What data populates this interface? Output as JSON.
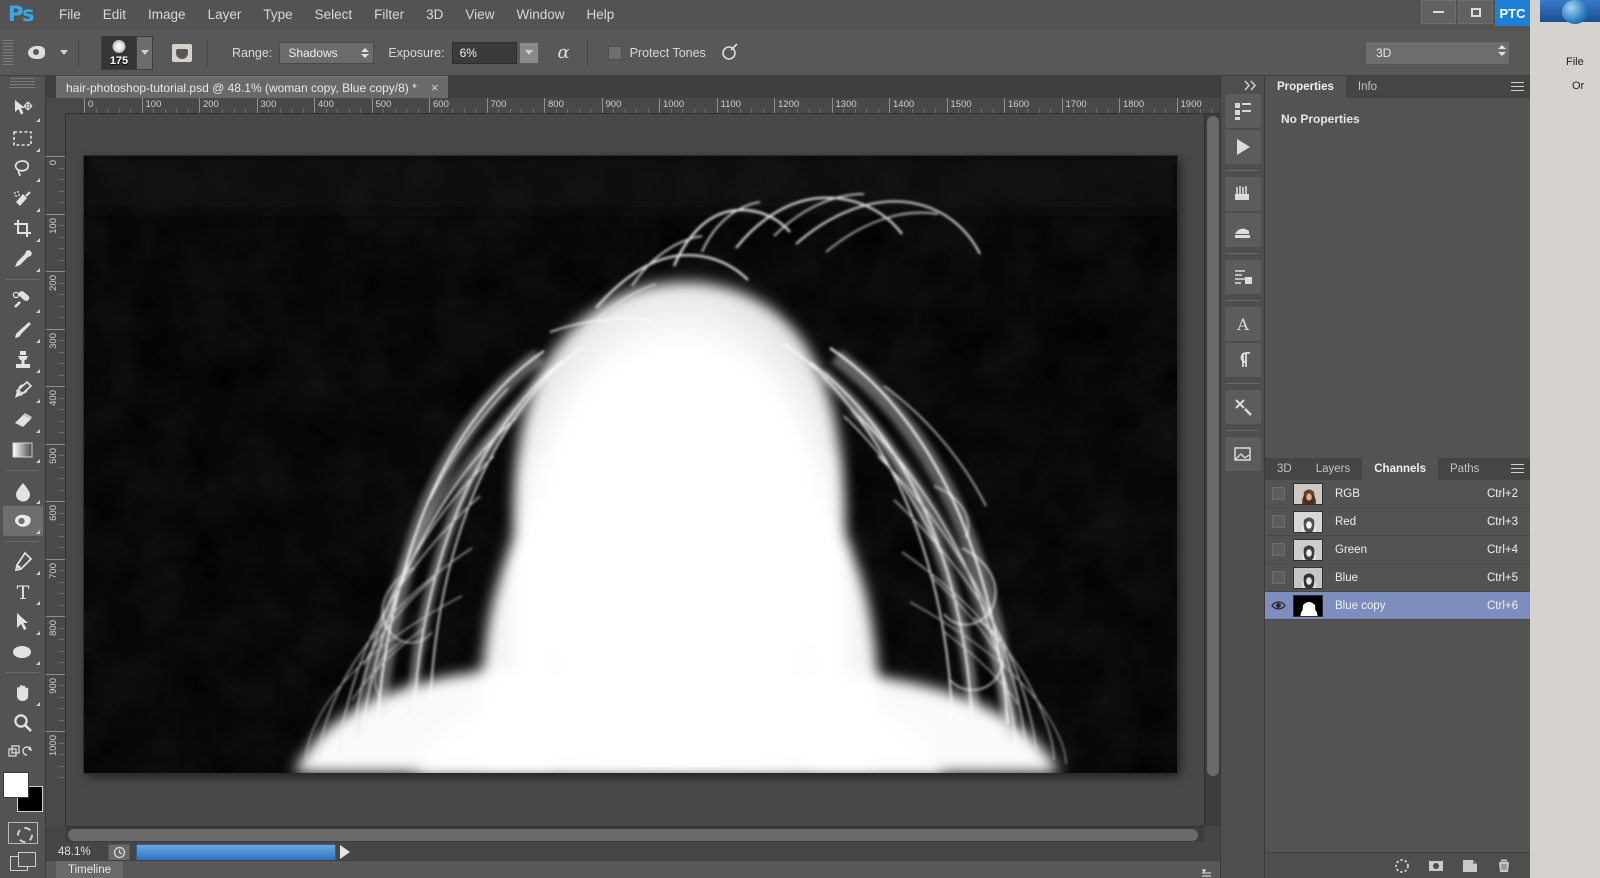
{
  "app": {
    "name": "Adobe Photoshop",
    "logo": "Ps"
  },
  "menubar": {
    "items": [
      "File",
      "Edit",
      "Image",
      "Layer",
      "Type",
      "Select",
      "Filter",
      "3D",
      "View",
      "Window",
      "Help"
    ]
  },
  "window_controls": {
    "minimize": "–",
    "maximize": "□",
    "badge": "PTC"
  },
  "options_bar": {
    "tool_icon": "burn-tool-icon",
    "brush_size": "175",
    "range_label": "Range:",
    "range_value": "Shadows",
    "exposure_label": "Exposure:",
    "exposure_value": "6%",
    "airbrush_icon": "airbrush-icon",
    "protect_tones_label": "Protect Tones",
    "protect_tones_checked": false,
    "tablet_pressure_icon": "tablet-pressure-icon",
    "workspace": "3D"
  },
  "toolbar": {
    "tools": [
      {
        "name": "move-tool",
        "has_flyout": true,
        "selected": false
      },
      {
        "name": "rectangular-marquee-tool",
        "has_flyout": true,
        "selected": false
      },
      {
        "name": "lasso-tool",
        "has_flyout": true,
        "selected": false
      },
      {
        "name": "quick-selection-tool",
        "has_flyout": true,
        "selected": false
      },
      {
        "name": "crop-tool",
        "has_flyout": true,
        "selected": false
      },
      {
        "name": "eyedropper-tool",
        "has_flyout": true,
        "selected": false
      },
      {
        "name": "spot-healing-brush-tool",
        "has_flyout": true,
        "selected": false
      },
      {
        "name": "brush-tool",
        "has_flyout": true,
        "selected": false
      },
      {
        "name": "clone-stamp-tool",
        "has_flyout": true,
        "selected": false
      },
      {
        "name": "history-brush-tool",
        "has_flyout": true,
        "selected": false
      },
      {
        "name": "eraser-tool",
        "has_flyout": true,
        "selected": false
      },
      {
        "name": "gradient-tool",
        "has_flyout": true,
        "selected": false
      },
      {
        "name": "blur-tool",
        "has_flyout": true,
        "selected": false
      },
      {
        "name": "dodge-burn-tool",
        "has_flyout": true,
        "selected": true
      },
      {
        "name": "pen-tool",
        "has_flyout": true,
        "selected": false
      },
      {
        "name": "type-tool",
        "has_flyout": true,
        "selected": false
      },
      {
        "name": "path-selection-tool",
        "has_flyout": true,
        "selected": false
      },
      {
        "name": "ellipse-shape-tool",
        "has_flyout": true,
        "selected": false
      },
      {
        "name": "hand-tool",
        "has_flyout": true,
        "selected": false
      },
      {
        "name": "zoom-tool",
        "has_flyout": false,
        "selected": false
      }
    ],
    "foreground_color": "#ffffff",
    "background_color": "#000000",
    "quick_mask_icon": "quick-mask-icon",
    "screen_mode_icon": "screen-mode-icon"
  },
  "document": {
    "tab_title": "hair-photoshop-tutorial.psd @ 48.1% (woman copy, Blue copy/8) *",
    "close_label": "×",
    "zoom": "48.1%",
    "ruler_units_h": [
      0,
      100,
      200,
      300,
      400,
      500,
      600,
      700,
      800,
      900,
      1000,
      1100,
      1200,
      1300,
      1400,
      1500,
      1600,
      1700,
      1800,
      1900
    ],
    "ruler_units_v": [
      0,
      100,
      200,
      300,
      400,
      500,
      600,
      700,
      800,
      900,
      1000
    ],
    "canvas_description": "black-and-white hair mask channel of a woman seen from behind, white silhouette on black"
  },
  "statusbar": {
    "zoom": "48.1%",
    "clock_icon": "timing-icon",
    "progress_percent": 100,
    "play_icon": "play-icon"
  },
  "timeline": {
    "label": "Timeline",
    "menu_icon": "panel-menu-icon"
  },
  "dock": {
    "collapse_icon": "collapse-to-icons-icon",
    "icons": [
      "mini-bridge-icon",
      "timeline-icon",
      "brush-panel-icon",
      "swatches-panel-icon",
      "adjustments-panel-icon",
      "character-panel-icon",
      "paragraph-panel-icon",
      "tool-presets-icon",
      "notes-panel-icon"
    ]
  },
  "properties_panel": {
    "tabs": [
      {
        "label": "Properties",
        "active": true
      },
      {
        "label": "Info",
        "active": false
      }
    ],
    "empty_message": "No Properties",
    "menu_icon": "panel-menu-icon"
  },
  "channels_panel": {
    "tabs": [
      {
        "label": "3D",
        "active": false
      },
      {
        "label": "Layers",
        "active": false
      },
      {
        "label": "Channels",
        "active": true
      },
      {
        "label": "Paths",
        "active": false
      }
    ],
    "menu_icon": "panel-menu-icon",
    "rows": [
      {
        "name": "RGB",
        "shortcut": "Ctrl+2",
        "visible": false,
        "selected": false,
        "thumb": "color"
      },
      {
        "name": "Red",
        "shortcut": "Ctrl+3",
        "visible": false,
        "selected": false,
        "thumb": "gray"
      },
      {
        "name": "Green",
        "shortcut": "Ctrl+4",
        "visible": false,
        "selected": false,
        "thumb": "gray"
      },
      {
        "name": "Blue",
        "shortcut": "Ctrl+5",
        "visible": false,
        "selected": false,
        "thumb": "gray"
      },
      {
        "name": "Blue copy",
        "shortcut": "Ctrl+6",
        "visible": true,
        "selected": true,
        "thumb": "mask"
      }
    ],
    "footer_icons": [
      "load-channel-as-selection-icon",
      "save-selection-as-channel-icon",
      "create-new-channel-icon",
      "delete-channel-icon"
    ]
  },
  "background_app": {
    "menu_label": "File",
    "submenu_label": "Or"
  },
  "colors": {
    "chrome": "#535353",
    "panel": "#535353",
    "selection_blue": "#7d8dbe",
    "accent_blue": "#1d7fd6",
    "progress_blue": "#2f74c4"
  }
}
